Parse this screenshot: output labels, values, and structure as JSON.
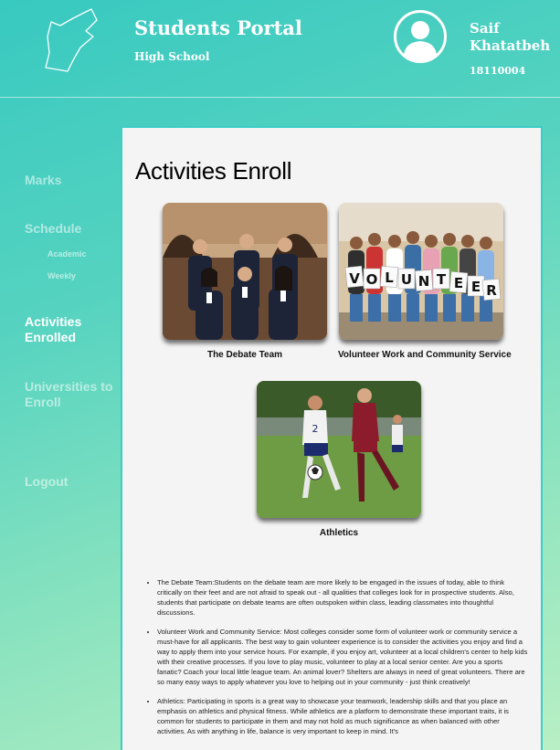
{
  "header": {
    "title": "Students Portal",
    "subtitle": "High School",
    "user_name": "Saif Khatatbeh",
    "user_id": "18110004"
  },
  "sidebar": {
    "items": [
      {
        "label": "Marks"
      },
      {
        "label": "Schedule"
      },
      {
        "label": "Activities Enrolled"
      },
      {
        "label": "Universities to Enroll"
      },
      {
        "label": "Logout"
      }
    ],
    "schedule_sub": [
      {
        "label": "Academic"
      },
      {
        "label": "Weekly"
      }
    ]
  },
  "main": {
    "heading": "Activities Enroll",
    "activities": [
      {
        "caption": "The Debate Team",
        "icon": "debate-team-photo"
      },
      {
        "caption": "Volunteer Work and Community Service",
        "icon": "volunteer-photo"
      },
      {
        "caption": "Athletics",
        "icon": "athletics-photo"
      }
    ],
    "volunteer_sign": "VOLUNTEER",
    "descriptions": [
      "The Debate Team:Students on the debate team are more likely to be engaged in the issues of today, able to think critically on their feet and are not afraid to speak out - all qualities that colleges look for in prospective students. Also, students that participate on debate teams are often outspoken within class, leading classmates into thoughtful discussions.",
      "Volunteer Work and Community Service: Most colleges consider some form of volunteer work or community service a must-have for all applicants. The best way to gain volunteer experience is to consider the activities you enjoy and find a way to apply them into your service hours. For example, if you enjoy art, volunteer at a local children's center to help kids with their creative processes. If you love to play music, volunteer to play at a local senior center. Are you a sports fanatic? Coach your local little league team. An animal lover? Shelters are always in need of great volunteers. There are so many easy ways to apply whatever you love to helping out in your community - just think creatively!",
      "Athletics: Participating in sports is a great way to showcase your teamwork, leadership skills and that you place an emphasis on athletics and physical fitness. While athletics are a platform to demonstrate these important traits, it is common for students to participate in them and may not hold as much significance as when balanced with other activities. As with anything in life, balance is very important to keep in mind. It's"
    ]
  },
  "colors": {
    "gradient_start": "#38c9c0",
    "gradient_end": "#b9efc4",
    "content_bg": "#f4f4f4",
    "content_border": "#3ccdc4"
  }
}
